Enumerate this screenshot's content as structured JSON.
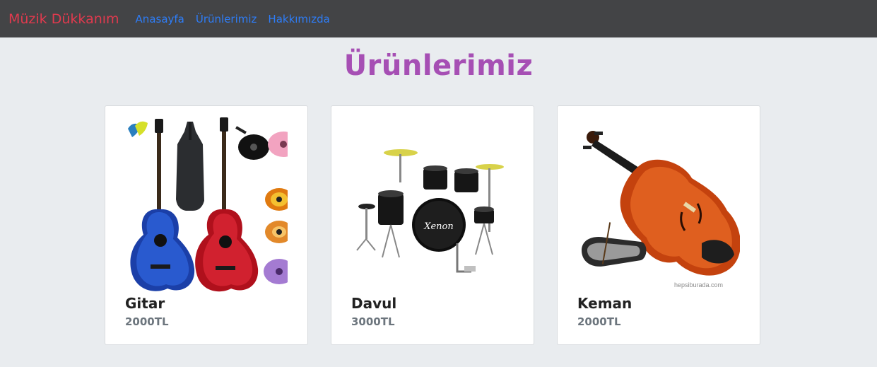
{
  "navbar": {
    "brand": "Müzik Dükkanım",
    "links": [
      "Anasayfa",
      "Ürünlerimiz",
      "Hakkımızda"
    ]
  },
  "page_title": "Ürünlerimiz",
  "products": [
    {
      "name": "Gitar",
      "price": "2000TL",
      "image": "guitar-set-image"
    },
    {
      "name": "Davul",
      "price": "3000TL",
      "image": "drum-kit-image"
    },
    {
      "name": "Keman",
      "price": "2000TL",
      "image": "violin-image"
    }
  ],
  "image_watermark": "hepsiburada.com",
  "drum_brand": "Xenon",
  "colors": {
    "navbar_bg": "#434446",
    "brand": "#e03a4e",
    "link": "#2e7df7",
    "title": "#a64fb4",
    "page_bg": "#e9ecef"
  }
}
